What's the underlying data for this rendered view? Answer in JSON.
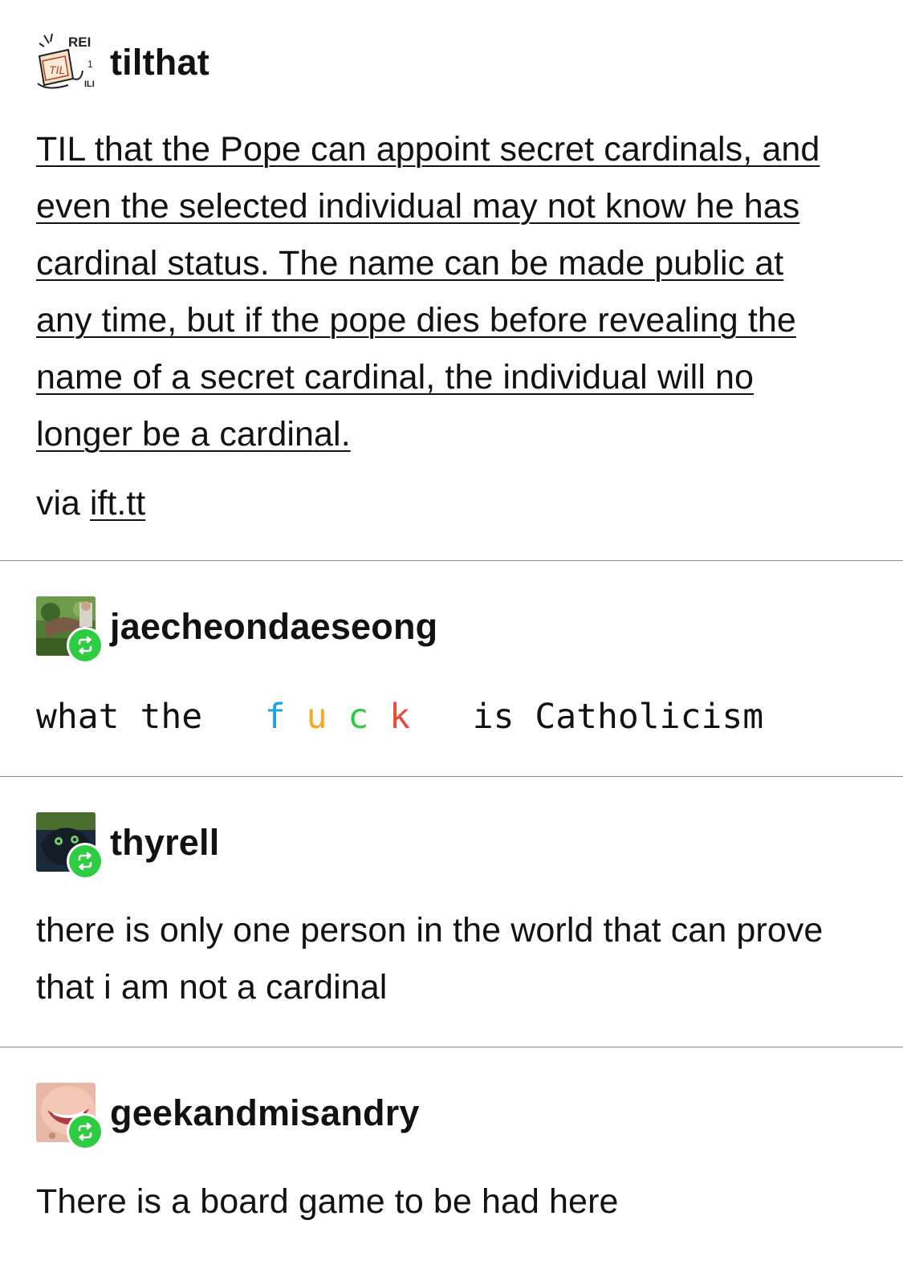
{
  "posts": [
    {
      "username": "tilthat",
      "avatar_icon": "til-logo-icon",
      "body_link_text": "TIL that the Pope can appoint secret cardinals, and even the selected individual may not know he has cardinal status. The name can be made public at any time, but if the pope dies before revealing the name of a secret cardinal, the individual will no longer be a cardinal.",
      "via_label": "via",
      "via_link": "ift.tt"
    },
    {
      "username": "jaecheondaeseong",
      "avatar_icon": "user-avatar-icon",
      "reblog_icon": "reblog-icon",
      "text_before": "what the",
      "colored_letters": [
        {
          "char": "f",
          "color": "#1aa3e8"
        },
        {
          "char": "u",
          "color": "#f5a623"
        },
        {
          "char": "c",
          "color": "#2ecc40"
        },
        {
          "char": "k",
          "color": "#e84a3c"
        }
      ],
      "text_after": "is Catholicism"
    },
    {
      "username": "thyrell",
      "avatar_icon": "user-avatar-icon",
      "reblog_icon": "reblog-icon",
      "body": "there is only one person in the world that can prove that i am not a cardinal"
    },
    {
      "username": "geekandmisandry",
      "avatar_icon": "user-avatar-icon",
      "reblog_icon": "reblog-icon",
      "body": "There is a board game to be had here"
    }
  ],
  "colors": {
    "reblog_green": "#2ecc40",
    "divider": "#8a8a8a",
    "text": "#121212"
  }
}
